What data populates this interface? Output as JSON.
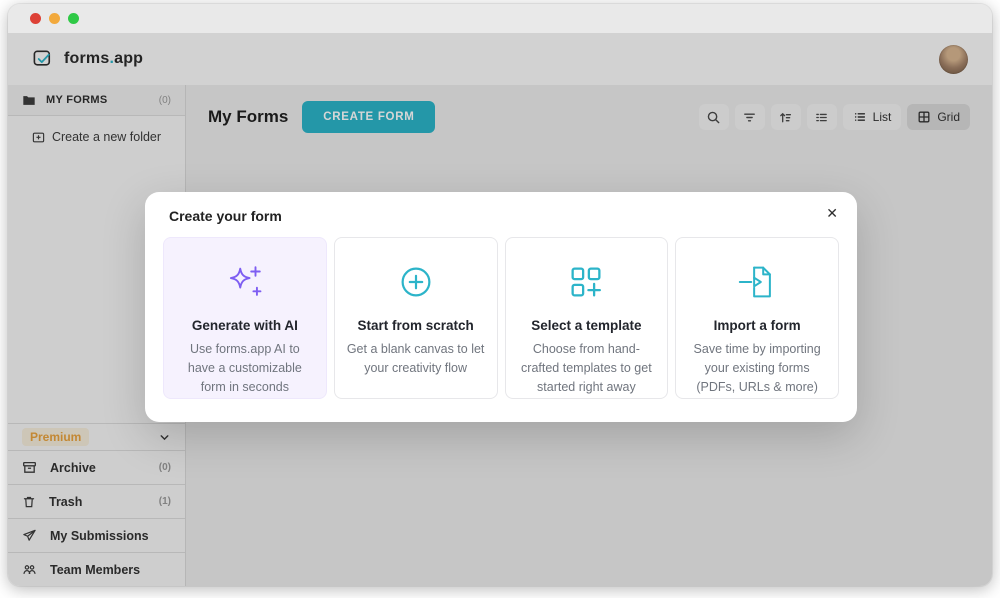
{
  "brand": {
    "part1": "forms",
    "dot": ".",
    "part2": "app"
  },
  "colors": {
    "teal": "#2cb4c9",
    "purple": "#7e5ef2",
    "orange": "#e9a23e"
  },
  "sidebar": {
    "my_forms_label": "MY FORMS",
    "my_forms_count": "(0)",
    "create_folder_label": "Create a new folder",
    "premium_label": "Premium",
    "items": [
      {
        "label": "Archive",
        "count": "(0)"
      },
      {
        "label": "Trash",
        "count": "(1)"
      },
      {
        "label": "My Submissions",
        "count": ""
      },
      {
        "label": "Team Members",
        "count": ""
      }
    ]
  },
  "content": {
    "title": "My Forms",
    "create_form_label": "CREATE FORM"
  },
  "toolbar": {
    "list_label": "List",
    "grid_label": "Grid"
  },
  "modal": {
    "title": "Create your form",
    "close_label": "✕",
    "cards": [
      {
        "title": "Generate with AI",
        "description": "Use forms.app AI to have a customizable form in seconds"
      },
      {
        "title": "Start from scratch",
        "description": "Get a blank canvas to let your creativity flow"
      },
      {
        "title": "Select a template",
        "description": "Choose from hand-crafted templates to get started right away"
      },
      {
        "title": "Import a form",
        "description": "Save time by importing your existing forms (PDFs, URLs & more)"
      }
    ]
  },
  "icons": [
    "forms-app-logo-icon",
    "folder-icon",
    "folder-plus-icon",
    "archive-icon",
    "trash-icon",
    "send-icon",
    "team-icon",
    "search-icon",
    "filter-icon",
    "sort-icon",
    "checklist-icon",
    "list-view-icon",
    "grid-view-icon",
    "ai-sparkles-icon",
    "circle-plus-icon",
    "template-plus-icon",
    "import-form-icon",
    "close-icon",
    "chevron-down-icon",
    "avatar"
  ]
}
